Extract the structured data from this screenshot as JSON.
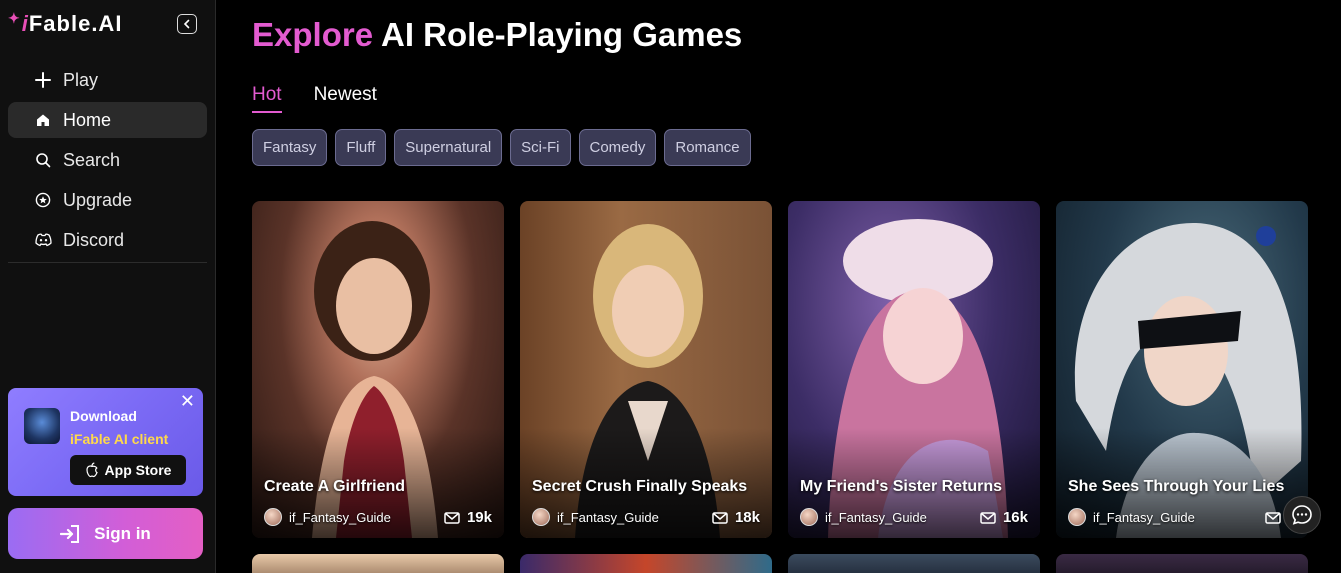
{
  "brand": {
    "logo_text": "Fable.AI",
    "logo_i": "i",
    "accent_color": "#e35bd0"
  },
  "sidebar": {
    "items": [
      {
        "label": "Play",
        "icon": "plus-icon"
      },
      {
        "label": "Home",
        "icon": "home-icon",
        "active": true
      },
      {
        "label": "Search",
        "icon": "search-icon"
      },
      {
        "label": "Upgrade",
        "icon": "star-icon"
      },
      {
        "label": "Discord",
        "icon": "discord-icon"
      }
    ],
    "promo": {
      "title": "Download",
      "subtitle": "iFable AI client",
      "button": "App Store"
    },
    "signin_label": "Sign in"
  },
  "main": {
    "title_accent": "Explore",
    "title_rest": "AI Role-Playing Games",
    "tabs": [
      {
        "label": "Hot",
        "active": true
      },
      {
        "label": "Newest"
      }
    ],
    "chips": [
      "Fantasy",
      "Fluff",
      "Supernatural",
      "Sci-Fi",
      "Comedy",
      "Romance"
    ],
    "cards": [
      {
        "title": "Create A Girlfriend",
        "author": "if_Fantasy_Guide",
        "count": "19k"
      },
      {
        "title": "Secret Crush Finally Speaks",
        "author": "if_Fantasy_Guide",
        "count": "18k"
      },
      {
        "title": "My Friend's Sister Returns",
        "author": "if_Fantasy_Guide",
        "count": "16k"
      },
      {
        "title": "She Sees Through Your Lies",
        "author": "if_Fantasy_Guide",
        "count": "1"
      }
    ]
  }
}
